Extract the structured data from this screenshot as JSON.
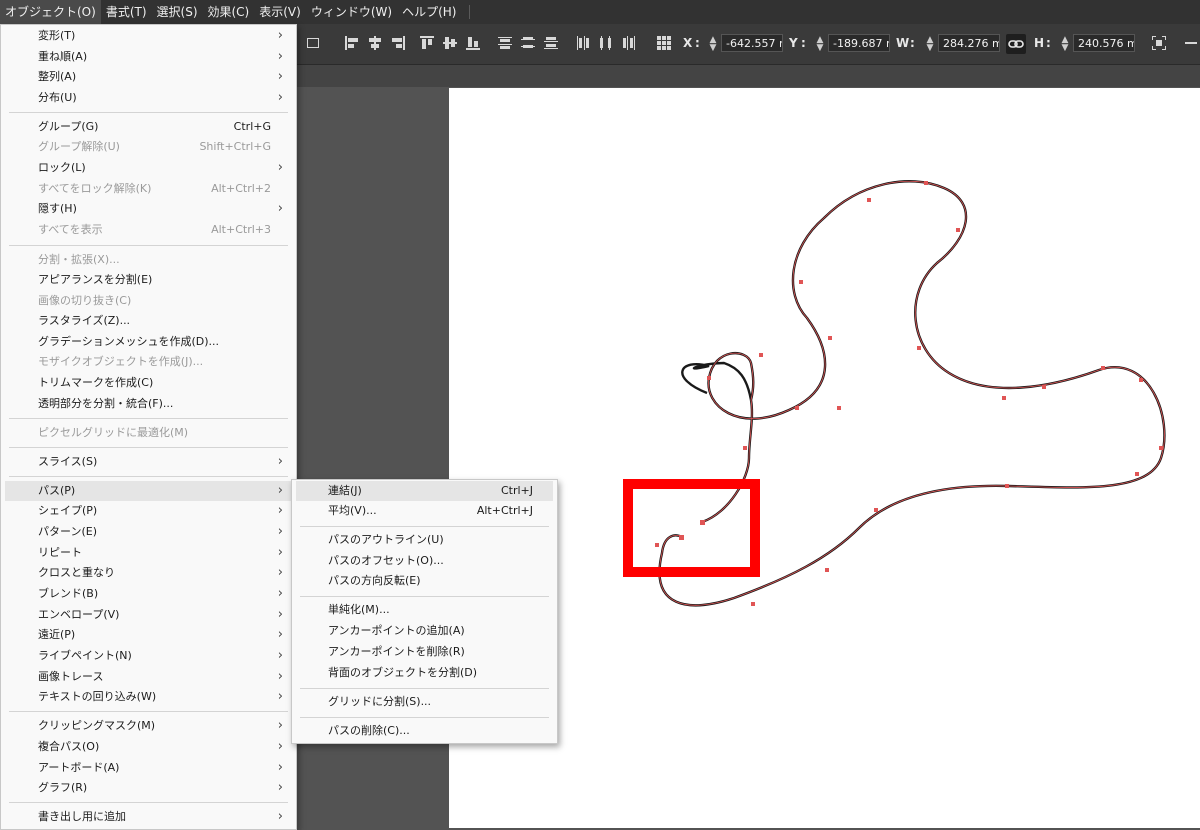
{
  "menubar": {
    "items": [
      "オブジェクト(O)",
      "書式(T)",
      "選択(S)",
      "効果(C)",
      "表示(V)",
      "ウィンドウ(W)",
      "ヘルプ(H)"
    ]
  },
  "controlbar": {
    "x_label": "X",
    "x_value": "-642.557 r",
    "y_label": "Y",
    "y_value": "-189.687 r",
    "w_label": "W",
    "w_value": "284.276 m",
    "h_label": "H",
    "h_value": "240.576 m"
  },
  "object_menu": {
    "items": [
      {
        "label": "変形(T)",
        "shortcut": "",
        "submenu": true,
        "disabled": false
      },
      {
        "label": "重ね順(A)",
        "shortcut": "",
        "submenu": true,
        "disabled": false
      },
      {
        "label": "整列(A)",
        "shortcut": "",
        "submenu": true,
        "disabled": false
      },
      {
        "label": "分布(U)",
        "shortcut": "",
        "submenu": true,
        "disabled": false
      },
      {
        "label": "グループ(G)",
        "shortcut": "Ctrl+G",
        "submenu": false,
        "disabled": false
      },
      {
        "label": "グループ解除(U)",
        "shortcut": "Shift+Ctrl+G",
        "submenu": false,
        "disabled": true
      },
      {
        "label": "ロック(L)",
        "shortcut": "",
        "submenu": true,
        "disabled": false
      },
      {
        "label": "すべてをロック解除(K)",
        "shortcut": "Alt+Ctrl+2",
        "submenu": false,
        "disabled": true
      },
      {
        "label": "隠す(H)",
        "shortcut": "",
        "submenu": true,
        "disabled": false
      },
      {
        "label": "すべてを表示",
        "shortcut": "Alt+Ctrl+3",
        "submenu": false,
        "disabled": true
      },
      {
        "label": "分割・拡張(X)...",
        "shortcut": "",
        "submenu": false,
        "disabled": true
      },
      {
        "label": "アピアランスを分割(E)",
        "shortcut": "",
        "submenu": false,
        "disabled": false
      },
      {
        "label": "画像の切り抜き(C)",
        "shortcut": "",
        "submenu": false,
        "disabled": true
      },
      {
        "label": "ラスタライズ(Z)...",
        "shortcut": "",
        "submenu": false,
        "disabled": false
      },
      {
        "label": "グラデーションメッシュを作成(D)...",
        "shortcut": "",
        "submenu": false,
        "disabled": false
      },
      {
        "label": "モザイクオブジェクトを作成(J)...",
        "shortcut": "",
        "submenu": false,
        "disabled": true
      },
      {
        "label": "トリムマークを作成(C)",
        "shortcut": "",
        "submenu": false,
        "disabled": false
      },
      {
        "label": "透明部分を分割・統合(F)...",
        "shortcut": "",
        "submenu": false,
        "disabled": false
      },
      {
        "label": "ピクセルグリッドに最適化(M)",
        "shortcut": "",
        "submenu": false,
        "disabled": true
      },
      {
        "label": "スライス(S)",
        "shortcut": "",
        "submenu": true,
        "disabled": false
      },
      {
        "label": "パス(P)",
        "shortcut": "",
        "submenu": true,
        "disabled": false,
        "highlighted": true
      },
      {
        "label": "シェイプ(P)",
        "shortcut": "",
        "submenu": true,
        "disabled": false
      },
      {
        "label": "パターン(E)",
        "shortcut": "",
        "submenu": true,
        "disabled": false
      },
      {
        "label": "リピート",
        "shortcut": "",
        "submenu": true,
        "disabled": false
      },
      {
        "label": "クロスと重なり",
        "shortcut": "",
        "submenu": true,
        "disabled": false
      },
      {
        "label": "ブレンド(B)",
        "shortcut": "",
        "submenu": true,
        "disabled": false
      },
      {
        "label": "エンベロープ(V)",
        "shortcut": "",
        "submenu": true,
        "disabled": false
      },
      {
        "label": "遠近(P)",
        "shortcut": "",
        "submenu": true,
        "disabled": false
      },
      {
        "label": "ライブペイント(N)",
        "shortcut": "",
        "submenu": true,
        "disabled": false
      },
      {
        "label": "画像トレース",
        "shortcut": "",
        "submenu": true,
        "disabled": false
      },
      {
        "label": "テキストの回り込み(W)",
        "shortcut": "",
        "submenu": true,
        "disabled": false
      },
      {
        "label": "クリッピングマスク(M)",
        "shortcut": "",
        "submenu": true,
        "disabled": false
      },
      {
        "label": "複合パス(O)",
        "shortcut": "",
        "submenu": true,
        "disabled": false
      },
      {
        "label": "アートボード(A)",
        "shortcut": "",
        "submenu": true,
        "disabled": false
      },
      {
        "label": "グラフ(R)",
        "shortcut": "",
        "submenu": true,
        "disabled": false
      },
      {
        "label": "書き出し用に追加",
        "shortcut": "",
        "submenu": true,
        "disabled": false
      }
    ]
  },
  "path_submenu": {
    "items": [
      {
        "label": "連結(J)",
        "shortcut": "Ctrl+J",
        "highlighted": true
      },
      {
        "label": "平均(V)...",
        "shortcut": "Alt+Ctrl+J"
      },
      {
        "label": "パスのアウトライン(U)",
        "shortcut": ""
      },
      {
        "label": "パスのオフセット(O)...",
        "shortcut": ""
      },
      {
        "label": "パスの方向反転(E)",
        "shortcut": ""
      },
      {
        "label": "単純化(M)...",
        "shortcut": ""
      },
      {
        "label": "アンカーポイントの追加(A)",
        "shortcut": ""
      },
      {
        "label": "アンカーポイントを削除(R)",
        "shortcut": ""
      },
      {
        "label": "背面のオブジェクトを分割(D)",
        "shortcut": ""
      },
      {
        "label": "グリッドに分割(S)...",
        "shortcut": ""
      },
      {
        "label": "パスの削除(C)...",
        "shortcut": ""
      }
    ]
  },
  "colors": {
    "path_stroke": "#1a1a1a",
    "anchor": "#e05555",
    "highlight_box": "#ff0000"
  }
}
